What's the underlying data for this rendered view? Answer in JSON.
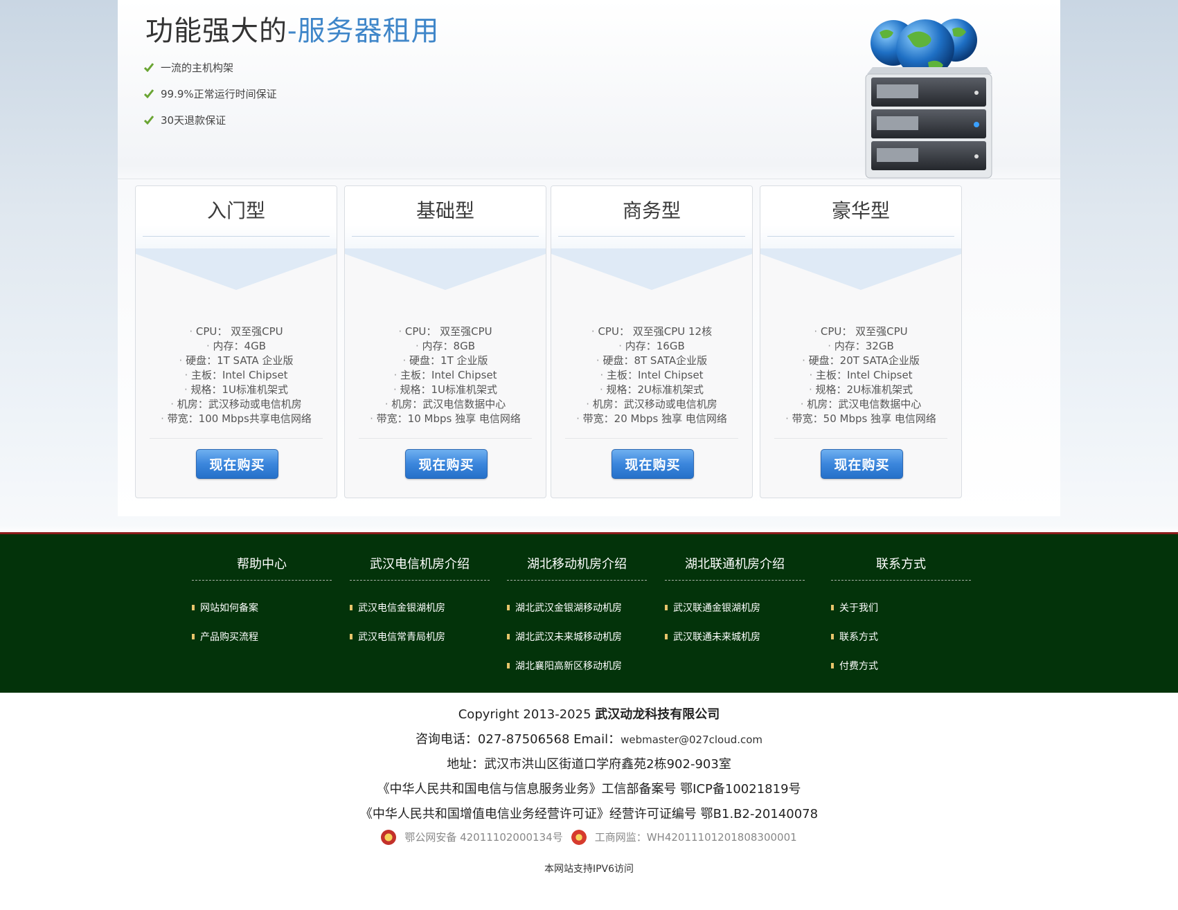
{
  "hero": {
    "title_main": "功能强大的",
    "title_accent": "-服务器租用",
    "features": [
      "一流的主机构架",
      "99.9%正常运行时间保证",
      "30天退款保证"
    ]
  },
  "plans": [
    {
      "name": "入门型",
      "button": "现在购买",
      "specs": [
        "CPU： 双至强CPU",
        "内存：4GB",
        "硬盘：1T SATA 企业版",
        "主板：Intel  Chipset",
        "规格：1U标准机架式",
        "机房：武汉移动或电信机房",
        "带宽：100 Mbps共享电信网络"
      ]
    },
    {
      "name": "基础型",
      "button": "现在购买",
      "specs": [
        "CPU： 双至强CPU",
        "内存：8GB",
        "硬盘：1T 企业版",
        "主板：Intel Chipset",
        "规格：1U标准机架式",
        "机房：武汉电信数据中心",
        "带宽：10 Mbps 独享 电信网络"
      ]
    },
    {
      "name": "商务型",
      "button": "现在购买",
      "specs": [
        "CPU： 双至强CPU 12核",
        "内存：16GB",
        "硬盘：8T SATA企业版",
        "主板：Intel Chipset",
        "规格：2U标准机架式",
        "机房：武汉移动或电信机房",
        "带宽：20 Mbps 独享 电信网络"
      ]
    },
    {
      "name": "豪华型",
      "button": "现在购买",
      "specs": [
        "CPU： 双至强CPU",
        "内存：32GB",
        "硬盘：20T SATA企业版",
        "主板：Intel Chipset",
        "规格：2U标准机架式",
        "机房：武汉电信数据中心",
        "带宽：50 Mbps 独享 电信网络"
      ]
    }
  ],
  "footer_nav": [
    {
      "title": "帮助中心",
      "items": [
        "网站如何备案",
        "产品购买流程"
      ]
    },
    {
      "title": "武汉电信机房介绍",
      "items": [
        "武汉电信金银湖机房",
        "武汉电信常青局机房"
      ]
    },
    {
      "title": "湖北移动机房介绍",
      "items": [
        "湖北武汉金银湖移动机房",
        "湖北武汉未来城移动机房",
        "湖北襄阳高新区移动机房"
      ]
    },
    {
      "title": "湖北联通机房介绍",
      "items": [
        "武汉联通金银湖机房",
        "武汉联通未来城机房"
      ]
    },
    {
      "title": "联系方式",
      "items": [
        "关于我们",
        "联系方式",
        "付费方式"
      ]
    }
  ],
  "footer_info": {
    "copyright_prefix": "Copyright 2013-2025 ",
    "company": "武汉动龙科技有限公司",
    "phone_label": "咨询电话：027-87506568 Email：",
    "email": "webmaster@027cloud.com",
    "address": "地址：武汉市洪山区街道口学府鑫苑2栋902-903室",
    "icp": "《中华人民共和国电信与信息服务业务》工信部备案号 鄂ICP备10021819号",
    "license": "《中华人民共和国增值电信业务经营许可证》经营许可证编号 鄂B1.B2-20140078",
    "police": "鄂公网安备 42011102000134号",
    "business": "工商网监：WH42011101201808300001",
    "ipv6": "本网站支持IPV6访问"
  },
  "colors": {
    "accent": "#3f86c9",
    "button": "#3b86dc",
    "footer_bg": "#03330a",
    "footer_border": "#8c1c1c",
    "bullet": "#e7c56b"
  },
  "icons": [
    "check-icon",
    "server-globe-icon",
    "police-badge-icon",
    "business-badge-icon"
  ]
}
